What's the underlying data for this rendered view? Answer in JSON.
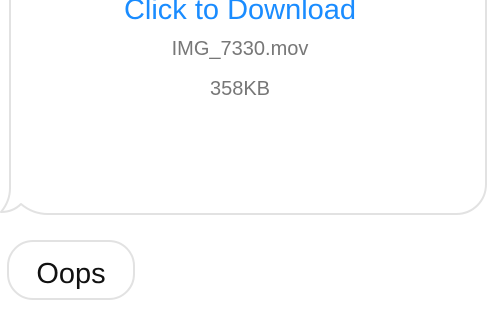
{
  "attachment": {
    "download_label": "Click to Download",
    "file_name": "IMG_7330.mov",
    "file_size": "358KB"
  },
  "messages": [
    {
      "text": "Oops"
    }
  ],
  "colors": {
    "link": "#1a8cff",
    "meta_text": "#777777",
    "bubble_border": "#e2e2e2",
    "message_text": "#111111"
  }
}
